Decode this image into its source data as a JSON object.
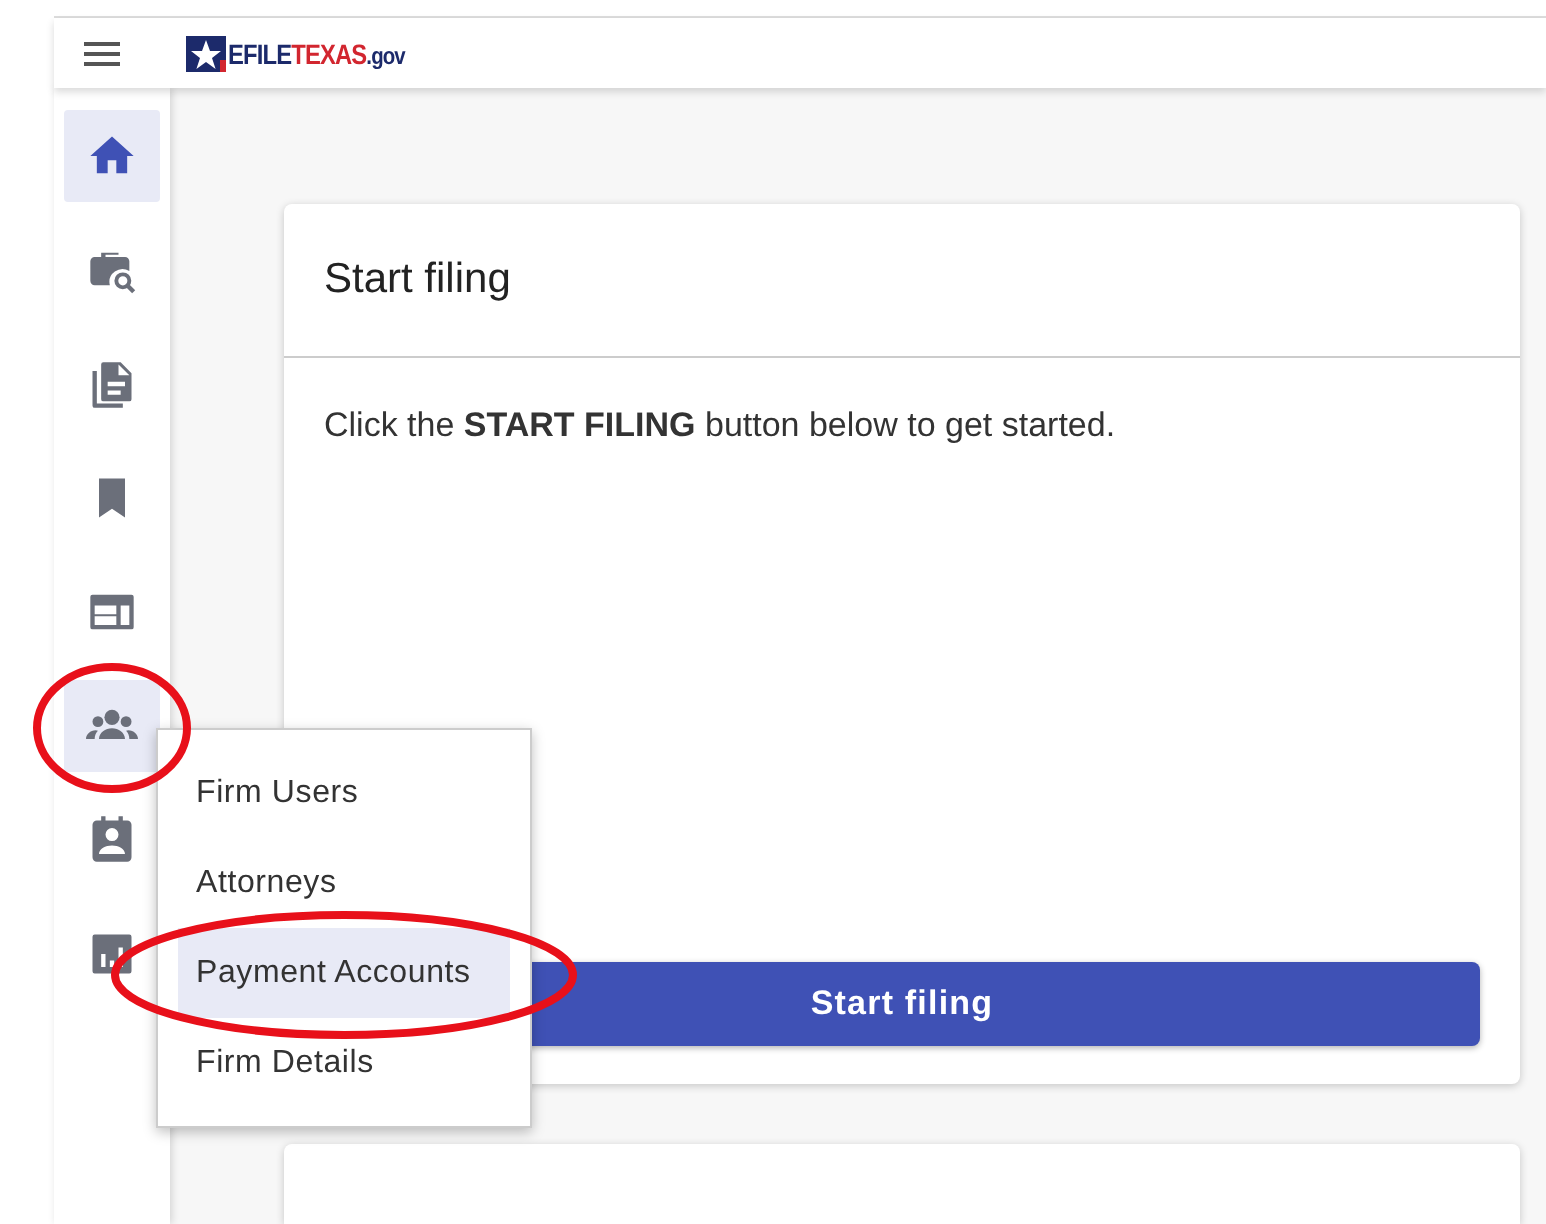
{
  "header": {
    "logo": [
      {
        "text": "EFILE",
        "color": "#1c2a6b"
      },
      {
        "text": "TEXAS",
        "color": "#d2262f"
      },
      {
        "text": ".gov",
        "color": "#1c2a6b"
      }
    ]
  },
  "sidebar": {
    "items": [
      {
        "kind": "home",
        "selected": true,
        "circled": false
      },
      {
        "kind": "search",
        "selected": false,
        "circled": false
      },
      {
        "kind": "documents",
        "selected": false,
        "circled": false
      },
      {
        "kind": "bookmark",
        "selected": false,
        "circled": false
      },
      {
        "kind": "layout",
        "selected": false,
        "circled": false
      },
      {
        "kind": "group",
        "selected": true,
        "circled": true
      },
      {
        "kind": "contact",
        "selected": false,
        "circled": false
      },
      {
        "kind": "report",
        "selected": false,
        "circled": false
      }
    ]
  },
  "menu": {
    "items": [
      {
        "label": "Firm Users",
        "selected": false,
        "circled": false
      },
      {
        "label": "Attorneys",
        "selected": false,
        "circled": false
      },
      {
        "label": "Payment Accounts",
        "selected": true,
        "circled": true
      },
      {
        "label": "Firm Details",
        "selected": false,
        "circled": false
      }
    ]
  },
  "card": {
    "title": "Start filing",
    "text": "Click the **START FILING** button below to get started.",
    "button": "Start filing"
  }
}
